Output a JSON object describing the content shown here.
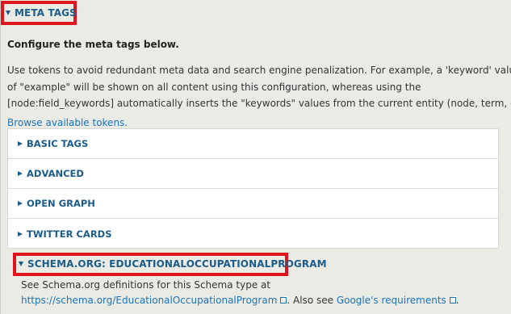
{
  "meta_tags": {
    "summary_label": "META TAGS",
    "description_title": "Configure the meta tags below.",
    "description_lines": [
      "Use tokens to avoid redundant meta data and search engine penalization. For example, a 'keyword' value",
      "of \"example\" will be shown on all content using this configuration, whereas using the",
      "[node:field_keywords] automatically inserts the \"keywords\" values from the current entity (node, term, etc)."
    ],
    "browse_tokens_link": "Browse available tokens."
  },
  "subpanels": [
    {
      "label": "BASIC TAGS"
    },
    {
      "label": "ADVANCED"
    },
    {
      "label": "OPEN GRAPH"
    },
    {
      "label": "TWITTER CARDS"
    }
  ],
  "schema": {
    "summary_label": "SCHEMA.ORG: EDUCATIONALOCCUPATIONALPROGRAM",
    "desc_prefix": "See Schema.org definitions for this Schema type at",
    "schema_link": "https://schema.org/EducationalOccupationalProgram",
    "desc_middle": ". Also see ",
    "google_link": "Google's requirements",
    "desc_suffix": "."
  },
  "icons": {
    "expanded": "triangle-down",
    "collapsed": "triangle-right",
    "external_link": "external-link-icon"
  },
  "colors": {
    "highlight": "#e0141c",
    "link": "#1b73b8",
    "summary": "#1b5c8a",
    "background": "#ebebe6"
  }
}
